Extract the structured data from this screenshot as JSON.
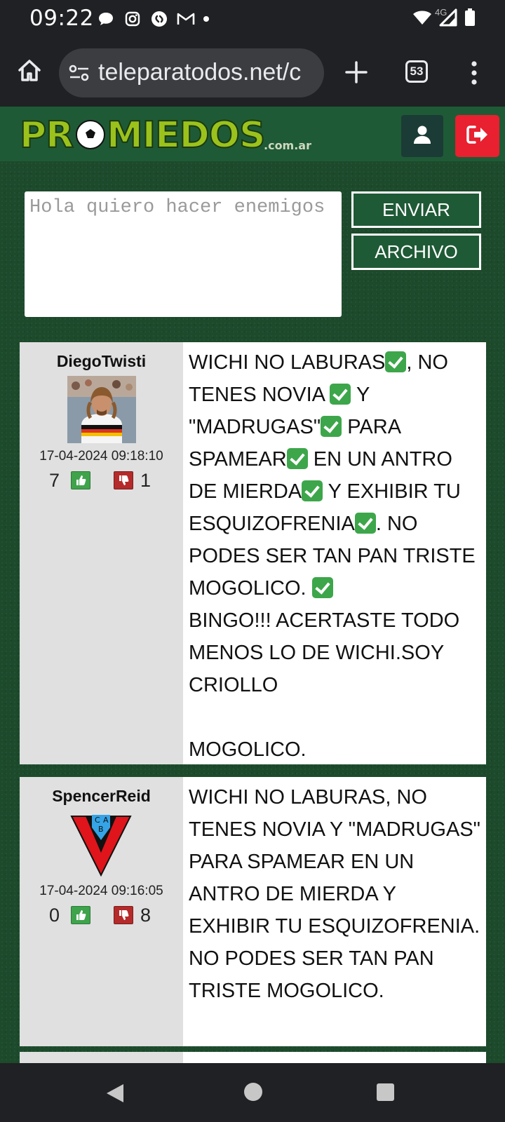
{
  "status_bar": {
    "time": "09:22",
    "network": "4G",
    "icons_left": [
      "message-bubble-icon",
      "instagram-icon",
      "shazam-icon",
      "gmail-icon",
      "dot-icon"
    ],
    "icons_right": [
      "wifi-icon",
      "signal-icon",
      "battery-icon"
    ]
  },
  "browser": {
    "url": "teleparatodos.net/c",
    "tab_count": "53"
  },
  "site": {
    "logo_text": "PROMIEDOS",
    "logo_suffix": ".com.ar",
    "colors": {
      "header_bg": "#1f5a36",
      "logout_bg": "#e8202f",
      "user_bg": "#1b3b36"
    }
  },
  "compose": {
    "placeholder": "Hola quiero hacer enemigos",
    "send_label": "ENVIAR",
    "archive_label": "ARCHIVO"
  },
  "posts": [
    {
      "username": "DiegoTwisti",
      "timestamp": "17-04-2024 09:18:10",
      "likes": "7",
      "dislikes": "1",
      "avatar": "player-photo-avatar",
      "text_parts": [
        "WICHI NO LABURAS",
        ", NO TENES NOVIA ",
        " Y \"MADRUGAS\"",
        " PARA SPAMEAR",
        " EN UN ANTRO DE MIERDA",
        " Y EXHIBIR TU ESQUIZOFRENIA",
        ". NO PODES SER TAN PAN TRISTE MOGOLICO. ",
        "\nBINGO!!! ACERTASTE TODO MENOS LO DE WICHI.SOY CRIOLLO\n\nMOGOLICO."
      ]
    },
    {
      "username": "SpencerReid",
      "timestamp": "17-04-2024 09:16:05",
      "likes": "0",
      "dislikes": "8",
      "avatar": "cab-shield-avatar",
      "avatar_letters": [
        "C",
        "A",
        "B"
      ],
      "text": "WICHI NO LABURAS, NO TENES NOVIA Y \"MADRUGAS\" PARA SPAMEAR EN UN ANTRO DE MIERDA Y EXHIBIR TU ESQUIZOFRENIA. NO PODES SER TAN PAN TRISTE MOGOLICO."
    }
  ]
}
